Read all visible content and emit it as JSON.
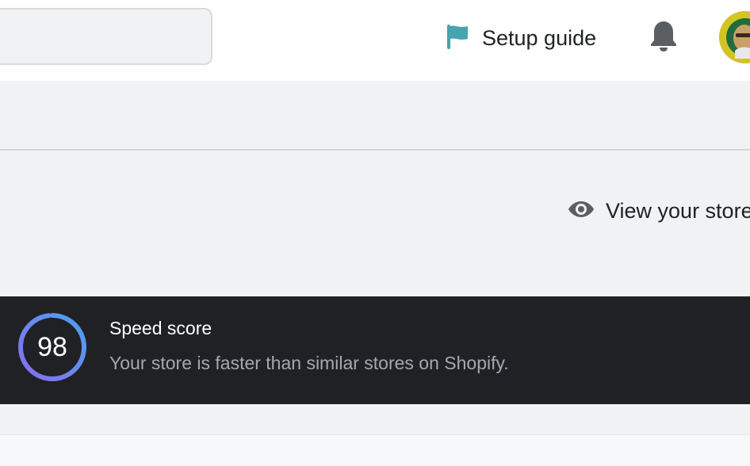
{
  "topbar": {
    "setup_guide_label": "Setup guide",
    "icons": {
      "setup_guide": "flag-icon",
      "notifications": "bell-icon",
      "avatar": "avatar"
    }
  },
  "header": {
    "view_store_label": "View your store",
    "view_store_icon": "eye-icon"
  },
  "speed_score": {
    "score": "98",
    "score_fraction": 0.98,
    "title": "Speed score",
    "description": "Your store is faster than similar stores on Shopify."
  },
  "colors": {
    "flag": "#47a3ad",
    "icon_gray": "#5c5f62",
    "card_bg": "#202125",
    "ring_start": "#8a6cf0",
    "ring_end": "#4aa2f0"
  }
}
